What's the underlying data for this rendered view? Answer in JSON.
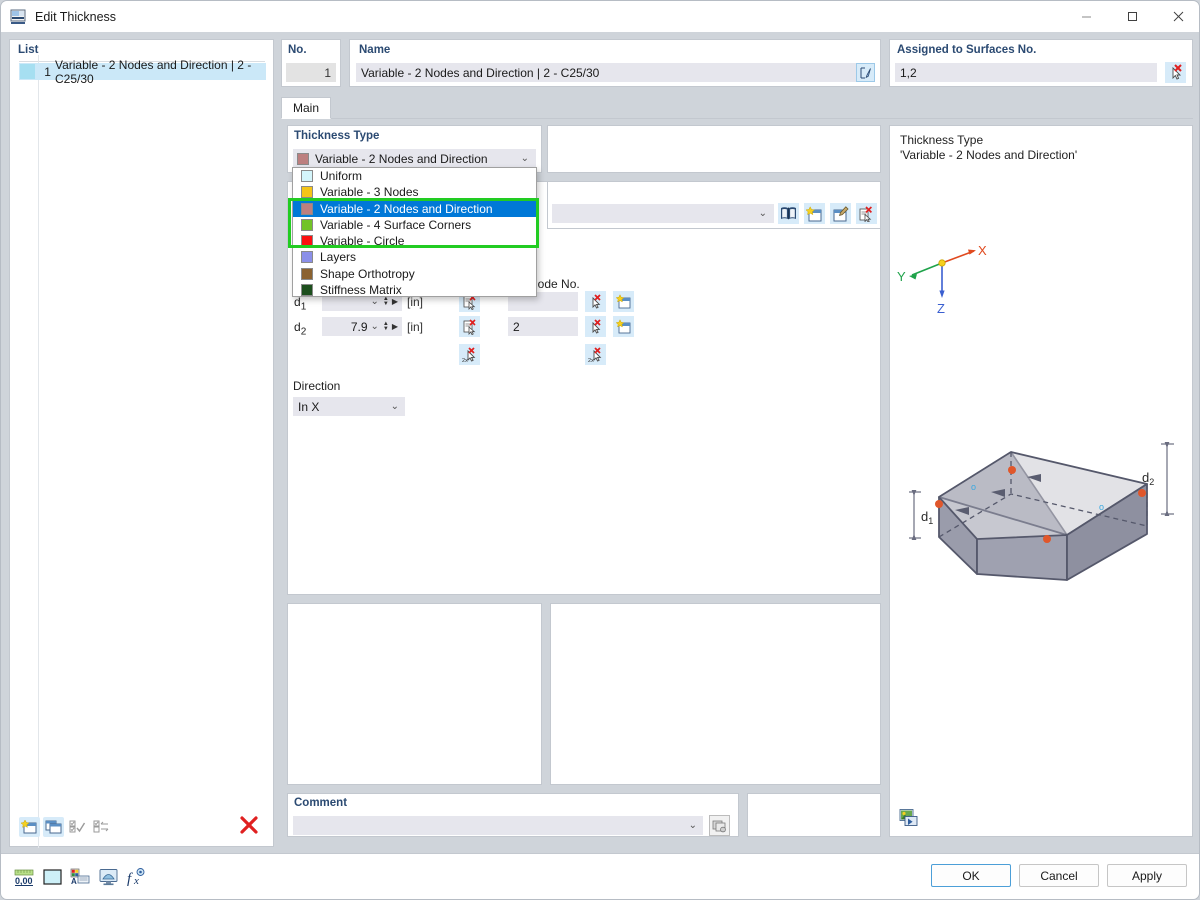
{
  "window": {
    "title": "Edit Thickness",
    "icon": "thickness-app-icon",
    "minimize": "—",
    "maximize": "❐",
    "close": "✕"
  },
  "list_panel": {
    "label": "List",
    "rows": [
      {
        "number": "1",
        "text": "Variable - 2 Nodes and Direction | 2 - C25/30",
        "swatch": "#a6dff1",
        "selected": true
      }
    ],
    "toolbar": [
      {
        "name": "new-thickness-button",
        "glyph": "new"
      },
      {
        "name": "copy-thickness-button",
        "glyph": "copy"
      },
      {
        "name": "select-all-button",
        "glyph": "checkall"
      },
      {
        "name": "invert-selection-button",
        "glyph": "checkswap"
      },
      {
        "name": "delete-thickness-button",
        "glyph": "x"
      }
    ]
  },
  "header": {
    "no_label": "No.",
    "no_value": "1",
    "name_label": "Name",
    "name_value": "Variable - 2 Nodes and Direction | 2 - C25/30",
    "name_edit_icon": "edit-pencil-icon",
    "assigned_label": "Assigned to Surfaces No.",
    "assigned_value": "1,2",
    "assigned_pick_icon": "pick-surface-icon"
  },
  "tabs": [
    {
      "label": "Main",
      "active": true
    }
  ],
  "thickness_type": {
    "group_label": "Thickness Type",
    "selected": {
      "label": "Variable - 2 Nodes and Direction",
      "color": "#bc7f7f"
    },
    "chevron": "⌄",
    "options": [
      {
        "label": "Uniform",
        "color": "#d4f5fb",
        "selected": false,
        "highlighted": false
      },
      {
        "label": "Variable - 3 Nodes",
        "color": "#f5c518",
        "selected": false,
        "highlighted": false
      },
      {
        "label": "Variable - 2 Nodes and Direction",
        "color": "#bc7f7f",
        "selected": true,
        "highlighted": true
      },
      {
        "label": "Variable - 4 Surface Corners",
        "color": "#72c328",
        "selected": false,
        "highlighted": true
      },
      {
        "label": "Variable - Circle",
        "color": "#fb1111",
        "selected": false,
        "highlighted": true
      },
      {
        "label": "Layers",
        "color": "#8b8fe8",
        "selected": false,
        "highlighted": false
      },
      {
        "label": "Shape Orthotropy",
        "color": "#8b6230",
        "selected": false,
        "highlighted": false
      },
      {
        "label": "Stiffness Matrix",
        "color": "#1d4f1d",
        "selected": false,
        "highlighted": false
      }
    ],
    "annotation_color": "#22cc22"
  },
  "material": {
    "value": "",
    "chevron": "⌄",
    "buttons": [
      {
        "name": "material-library-button",
        "icon": "book-icon"
      },
      {
        "name": "new-material-button",
        "icon": "new-material-icon"
      },
      {
        "name": "edit-material-button",
        "icon": "edit-material-icon"
      },
      {
        "name": "select-material-button",
        "icon": "pick-material-icon"
      }
    ]
  },
  "parameters": {
    "node_no_label": "Node No.",
    "rows": [
      {
        "name": "d1",
        "value": "",
        "unit": "[in]",
        "node": ""
      },
      {
        "name": "d2",
        "value": "7.9",
        "unit": "[in]",
        "node": "2"
      }
    ],
    "direction_label": "Direction",
    "direction_value": "In X",
    "direction_chevron": "⌄"
  },
  "comment": {
    "label": "Comment",
    "value": "",
    "chevron": "⌄",
    "button_icon": "comment-library-icon"
  },
  "info_panel": {
    "title": "Thickness Type",
    "subtitle": "'Variable - 2 Nodes and Direction'",
    "axes": {
      "x": "X",
      "y": "Y",
      "z": "Z",
      "x_color": "#e04a1f",
      "y_color": "#1fa34a",
      "z_color": "#3a5fd0"
    },
    "diagram": {
      "d1_label": "d",
      "d1_sub": "1",
      "d2_label": "d",
      "d2_sub": "2"
    },
    "image_button_icon": "picture-icon"
  },
  "bottom": {
    "tools": [
      {
        "name": "units-button",
        "icon": "number-format-icon",
        "label": "0,00"
      },
      {
        "name": "color-button",
        "icon": "color-swatch-icon"
      },
      {
        "name": "display-properties-button",
        "icon": "display-props-icon"
      },
      {
        "name": "graphic-button",
        "icon": "graphic-icon"
      },
      {
        "name": "formula-button",
        "icon": "function-icon",
        "label": "f"
      }
    ],
    "buttons": [
      {
        "label": "OK",
        "default": true
      },
      {
        "label": "Cancel",
        "default": false
      },
      {
        "label": "Apply",
        "default": false
      }
    ]
  }
}
